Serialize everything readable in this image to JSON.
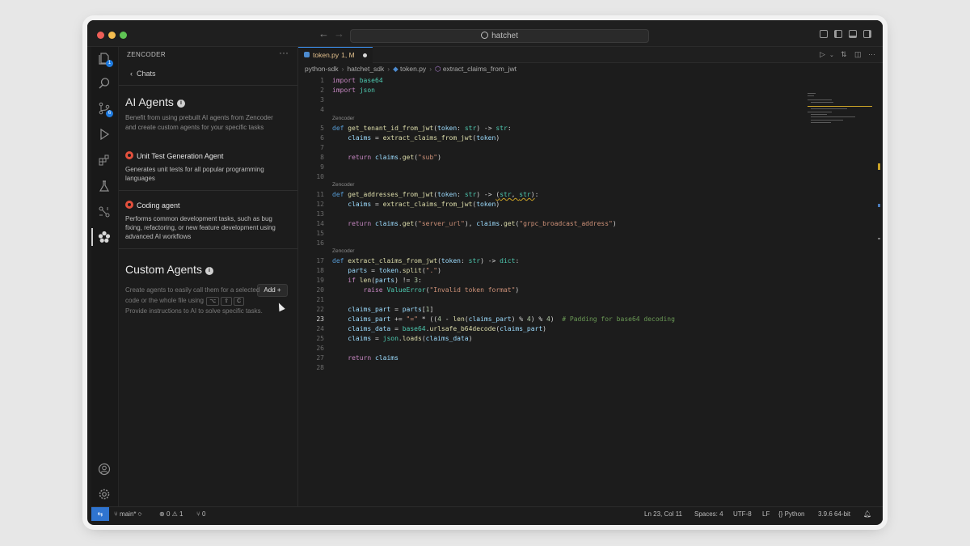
{
  "titlebar": {
    "search_text": "hatchet"
  },
  "sidebar": {
    "title": "ZENCODER",
    "back_label": "Chats",
    "ai_agents": {
      "title": "AI Agents",
      "description": "Benefit from using prebuilt AI agents from Zencoder and create custom agents for your specific tasks",
      "agents": [
        {
          "name": "Unit Test Generation Agent",
          "description": "Generates unit tests for all popular programming languages"
        },
        {
          "name": "Coding agent",
          "description": "Performs common development tasks, such as bug fixing, refactoring, or new feature development using advanced AI workflows"
        }
      ]
    },
    "custom_agents": {
      "title": "Custom Agents",
      "add_label": "Add +",
      "description_1": "Create agents to easily call them for a selected",
      "description_2": "code or the whole file using",
      "description_3": "Provide instructions to AI to solve specific tasks.",
      "keys": [
        "⌥",
        "⇧",
        "C"
      ]
    }
  },
  "activity_bar": {
    "icons": [
      "explorer-icon",
      "search-icon",
      "source-control-icon",
      "run-debug-icon",
      "extensions-icon",
      "testing-icon",
      "graph-icon",
      "zencoder-icon",
      "account-icon",
      "settings-icon"
    ],
    "badges": {
      "explorer": "1",
      "source_control": "6"
    }
  },
  "editor": {
    "tab": {
      "label": "token.py",
      "status": "1, M"
    },
    "breadcrumb": [
      "python-sdk",
      "hatchet_sdk",
      "token.py",
      "extract_claims_from_jwt"
    ],
    "lens_label": "Zencoder",
    "lines": [
      "1",
      "2",
      "3",
      "4",
      "5",
      "6",
      "7",
      "8",
      "9",
      "10",
      "11",
      "12",
      "13",
      "14",
      "15",
      "16",
      "17",
      "18",
      "19",
      "20",
      "21",
      "22",
      "23",
      "24",
      "25",
      "26",
      "27",
      "28"
    ]
  },
  "statusbar": {
    "branch": "main*",
    "errors": "0",
    "warnings": "1",
    "ports": "0",
    "position": "Ln 23, Col 11",
    "spaces": "Spaces: 4",
    "encoding": "UTF-8",
    "eol": "LF",
    "language": "Python",
    "interpreter": "3.9.6 64-bit"
  }
}
